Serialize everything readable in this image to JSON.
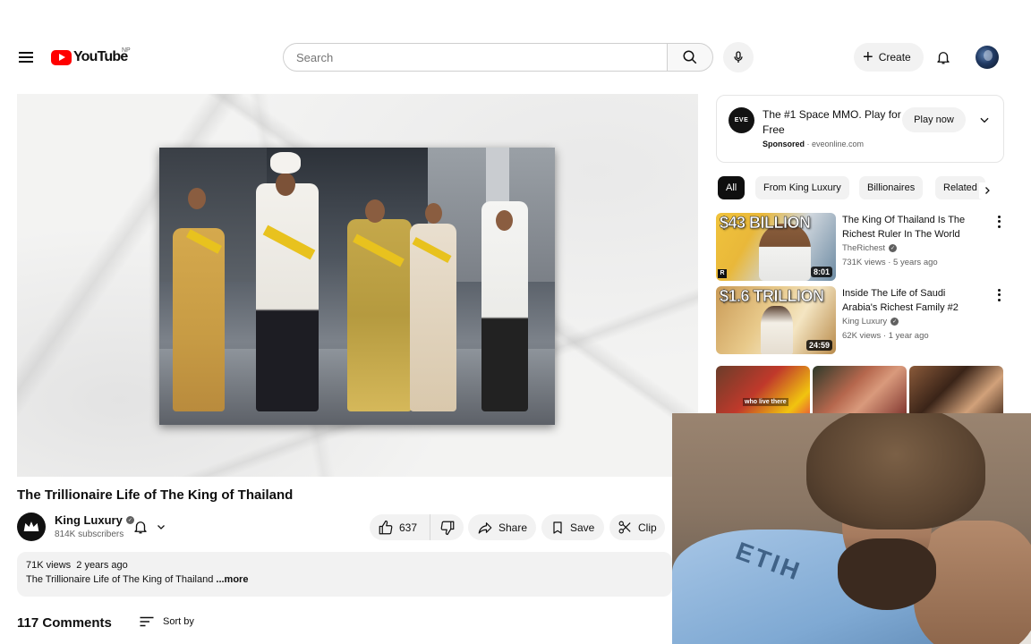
{
  "masthead": {
    "logo_text": "YouTube",
    "country_code": "NP",
    "search_placeholder": "Search",
    "create_label": "Create"
  },
  "video": {
    "title": "The Trillionaire Life of The King of Thailand",
    "channel_name": "King Luxury",
    "subscribers": "814K subscribers",
    "likes": "637",
    "share_label": "Share",
    "save_label": "Save",
    "clip_label": "Clip",
    "views": "71K views",
    "age": "2 years ago",
    "description": "The Trillionaire Life of The King of Thailand ",
    "more_label": "...more"
  },
  "comments": {
    "count_label": "117 Comments",
    "sort_label": "Sort by"
  },
  "ad": {
    "logo_text": "EVE",
    "title": "The #1 Space MMO. Play for Free",
    "sponsored_label": "Sponsored",
    "domain": "eveonline.com",
    "cta_label": "Play now"
  },
  "chips": [
    "All",
    "From King Luxury",
    "Billionaires",
    "Related"
  ],
  "recommendations": [
    {
      "thumb_text": "$43 BILLION",
      "duration": "8:01",
      "title": "The King Of Thailand Is The Richest Ruler In The World",
      "channel": "TheRichest",
      "meta": "731K views · 5 years ago"
    },
    {
      "thumb_text": "$1.6 TRILLION",
      "duration": "24:59",
      "title": "Inside The Life of Saudi Arabia's Richest Family #2",
      "channel": "King Luxury",
      "meta": "62K views · 1 year ago"
    }
  ],
  "shorts": [
    {
      "caption": "who live there"
    },
    {
      "caption": ""
    },
    {
      "caption": ""
    }
  ],
  "colors": {
    "brand_red": "#ff0000",
    "chip_active": "#0f0f0f",
    "chip_bg": "#f2f2f2",
    "secondary_text": "#606060"
  }
}
